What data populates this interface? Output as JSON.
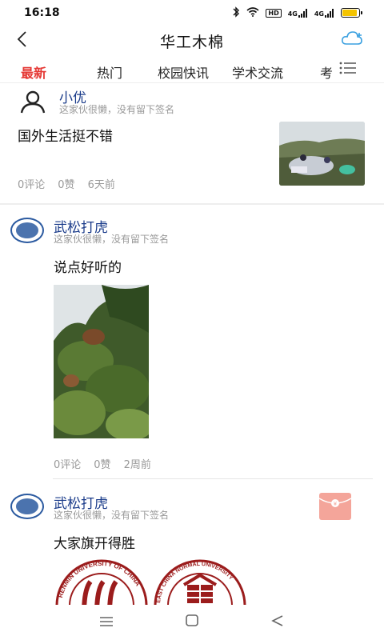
{
  "status": {
    "time": "16:18",
    "net1": "4G",
    "net2": "4G",
    "hd": "HD"
  },
  "header": {
    "title": "华工木棉"
  },
  "tabs": [
    {
      "label": "最新",
      "active": true
    },
    {
      "label": "热门",
      "active": false
    },
    {
      "label": "校园快讯",
      "active": false
    },
    {
      "label": "学术交流",
      "active": false
    },
    {
      "label": "考",
      "active": false
    }
  ],
  "posts": [
    {
      "author": "小优",
      "signature": "这家伙很懒，没有留下签名",
      "content": "国外生活挺不错",
      "comments": "0评论",
      "likes": "0赞",
      "time": "6天前"
    },
    {
      "author": "武松打虎",
      "signature": "这家伙很懒，没有留下签名",
      "content": "说点好听的",
      "comments": "0评论",
      "likes": "0赞",
      "time": "2周前"
    },
    {
      "author": "武松打虎",
      "signature": "这家伙很懒，没有留下签名",
      "content": "大家旗开得胜",
      "logo1_text": "RENMIN UNIVERSITY OF CHINA",
      "logo2_text": "EAST CHINA NORMAL UNIVERSITY"
    }
  ],
  "colors": {
    "accent": "#e53935",
    "author": "#1a3b8a",
    "muted": "#999999",
    "icon": "#3aa0e0",
    "redpacket": "#f4a59a"
  },
  "icons": {
    "back": "chevron-left-icon",
    "cloud": "cloud-add-icon",
    "menu": "list-menu-icon",
    "redpacket": "red-packet-icon"
  }
}
